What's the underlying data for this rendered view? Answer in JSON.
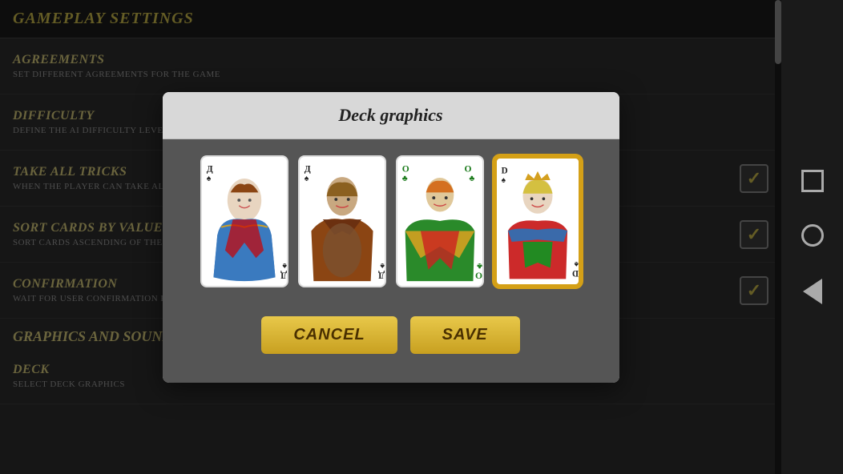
{
  "page": {
    "title": "Gameplay settings"
  },
  "settings": [
    {
      "id": "agreements",
      "title": "Agreements",
      "description": "Set different agreements for the game",
      "has_checkbox": false,
      "is_section": false
    },
    {
      "id": "difficulty",
      "title": "Difficulty",
      "description": "Define the AI difficulty level",
      "has_checkbox": false,
      "is_section": false
    },
    {
      "id": "take_all_tricks",
      "title": "Take all tricks",
      "description": "When the player can take all",
      "has_checkbox": true,
      "checked": true
    },
    {
      "id": "sort_cards_by_value",
      "title": "Sort cards by value",
      "description": "Sort cards ascending of the",
      "has_checkbox": true,
      "checked": true
    },
    {
      "id": "confirmation",
      "title": "Confirmation",
      "description": "Wait for user confirmation for button",
      "has_checkbox": true,
      "checked": true
    }
  ],
  "section_graphics": {
    "title": "Graphics and Sounds"
  },
  "section_deck": {
    "title": "Deck",
    "description": "Select deck graphics"
  },
  "modal": {
    "title": "Deck graphics",
    "cards": [
      {
        "id": "card1",
        "label": "Д",
        "suit": "♠",
        "selected": false
      },
      {
        "id": "card2",
        "label": "Д",
        "suit": "♠",
        "selected": false
      },
      {
        "id": "card3",
        "label": "О",
        "suit": "♣",
        "selected": false
      },
      {
        "id": "card4",
        "label": "D",
        "suit": "♠",
        "selected": true
      }
    ],
    "cancel_label": "Cancel",
    "save_label": "Save"
  },
  "android_nav": {
    "square_label": "recent-apps",
    "circle_label": "home",
    "triangle_label": "back"
  }
}
